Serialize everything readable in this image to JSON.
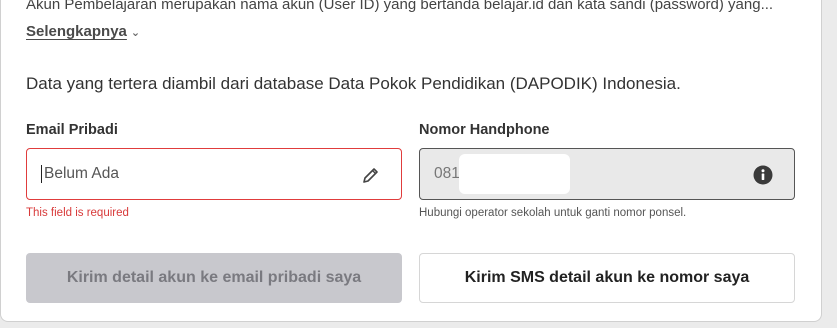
{
  "intro": {
    "text": "Akun Pembelajaran merupakan nama akun (User ID) yang bertanda belajar.id dan kata sandi (password) yang...",
    "more_label": "Selengkapnya"
  },
  "notice": "Data yang tertera diambil dari database Data Pokok Pendidikan (DAPODIK) Indonesia.",
  "email": {
    "label": "Email Pribadi",
    "placeholder": "Belum Ada",
    "error": "This field is required"
  },
  "phone": {
    "label": "Nomor Handphone",
    "prefix": "081",
    "hint": "Hubungi operator sekolah untuk ganti nomor ponsel."
  },
  "buttons": {
    "email_label": "Kirim detail akun ke email pribadi saya",
    "sms_label": "Kirim SMS detail akun ke nomor saya"
  },
  "icons": {
    "more": "chevron-down-icon",
    "edit": "pencil-icon",
    "info": "info-icon"
  },
  "colors": {
    "error": "#d83a3a",
    "disabled_button": "#c8c8cd"
  }
}
